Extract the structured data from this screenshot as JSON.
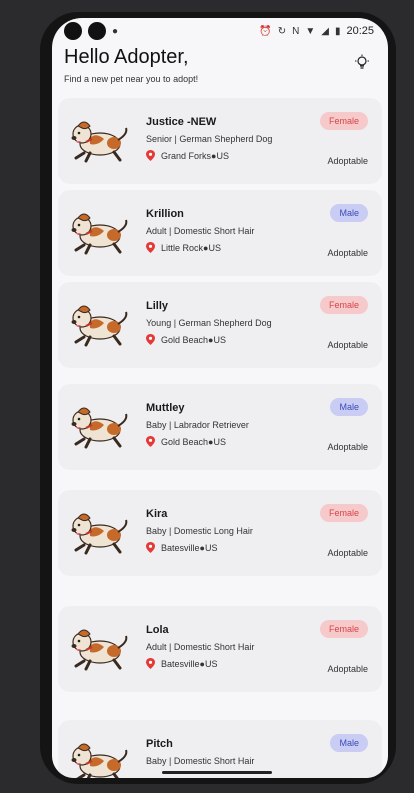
{
  "status_bar": {
    "time": "20:25",
    "icons": [
      "alarm-icon",
      "sync-icon",
      "nfc-icon",
      "wifi-icon",
      "signal-icon",
      "battery-icon"
    ]
  },
  "header": {
    "greeting": "Hello Adopter,",
    "subtitle": "Find a new pet near you to adopt!",
    "theme_icon": "lightbulb-icon"
  },
  "pets": [
    {
      "name": "Justice -NEW",
      "info": "Senior | German Shepherd Dog",
      "location": "Grand Forks●US",
      "gender": "Female",
      "status": "Adoptable"
    },
    {
      "name": "Krillion",
      "info": "Adult | Domestic Short Hair",
      "location": "Little Rock●US",
      "gender": "Male",
      "status": "Adoptable"
    },
    {
      "name": "Lilly",
      "info": "Young | German Shepherd Dog",
      "location": "Gold Beach●US",
      "gender": "Female",
      "status": "Adoptable"
    },
    {
      "name": "Muttley",
      "info": "Baby | Labrador Retriever",
      "location": "Gold Beach●US",
      "gender": "Male",
      "status": "Adoptable"
    },
    {
      "name": "Kira",
      "info": "Baby | Domestic Long Hair",
      "location": "Batesville●US",
      "gender": "Female",
      "status": "Adoptable"
    },
    {
      "name": "Lola",
      "info": "Adult | Domestic Short Hair",
      "location": "Batesville●US",
      "gender": "Female",
      "status": "Adoptable"
    },
    {
      "name": "Pitch",
      "info": "Baby | Domestic Short Hair",
      "location": "",
      "gender": "Male",
      "status": ""
    }
  ],
  "colors": {
    "female_bg": "#f6c9ca",
    "female_text": "#d64649",
    "male_bg": "#c9ccf3",
    "male_text": "#3c4bb8",
    "pin": "#e53935"
  }
}
